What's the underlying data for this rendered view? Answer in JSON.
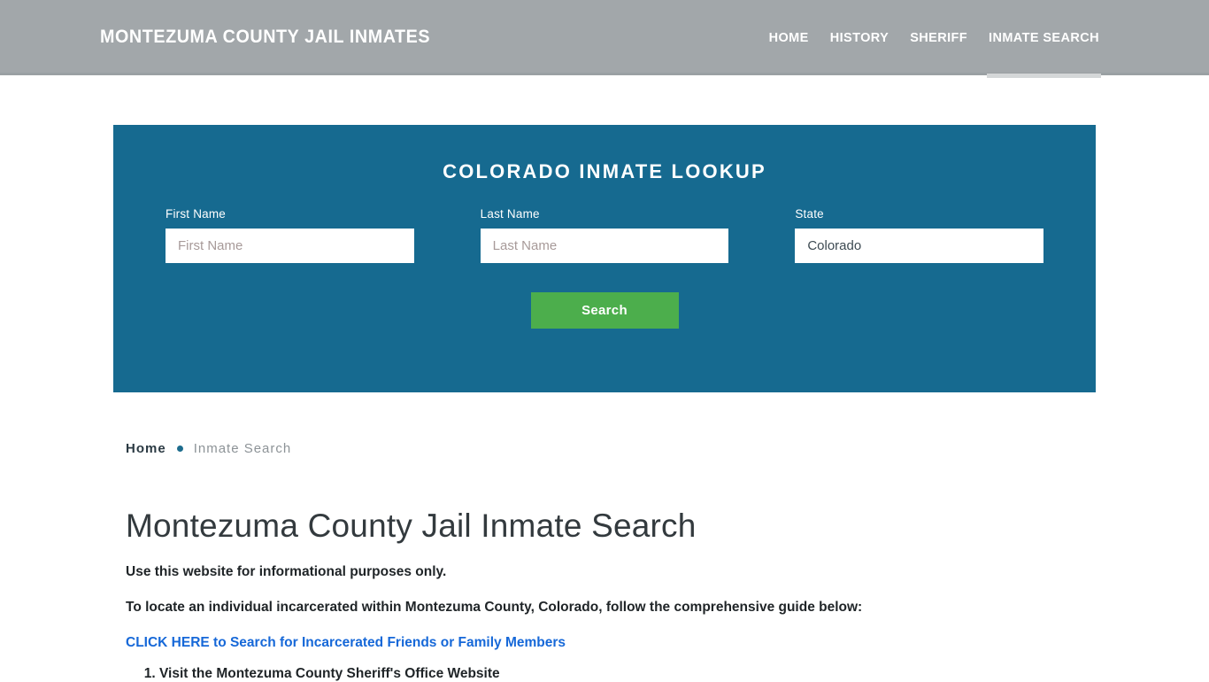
{
  "header": {
    "brand": "MONTEZUMA COUNTY JAIL INMATES",
    "nav": [
      {
        "label": "HOME",
        "active": false
      },
      {
        "label": "HISTORY",
        "active": false
      },
      {
        "label": "SHERIFF",
        "active": false
      },
      {
        "label": "INMATE SEARCH",
        "active": true
      }
    ]
  },
  "lookup": {
    "title": "COLORADO INMATE LOOKUP",
    "fields": {
      "first_name": {
        "label": "First Name",
        "placeholder": "First Name",
        "value": ""
      },
      "last_name": {
        "label": "Last Name",
        "placeholder": "Last Name",
        "value": ""
      },
      "state": {
        "label": "State",
        "placeholder": "State",
        "value": "Colorado"
      }
    },
    "search_label": "Search",
    "panel_color": "#166a90",
    "button_color": "#4cae4c"
  },
  "breadcrumb": {
    "home": "Home",
    "separator": "•",
    "current": "Inmate Search"
  },
  "main": {
    "title": "Montezuma County Jail Inmate Search",
    "paragraph_1": "Use this website for informational purposes only.",
    "paragraph_2": "To locate an individual incarcerated within Montezuma County, Colorado, follow the comprehensive guide below:",
    "cta_link": "CLICK HERE to Search for Incarcerated Friends or Family Members",
    "steps": [
      "Visit the Montezuma County Sheriff's Office Website"
    ]
  }
}
